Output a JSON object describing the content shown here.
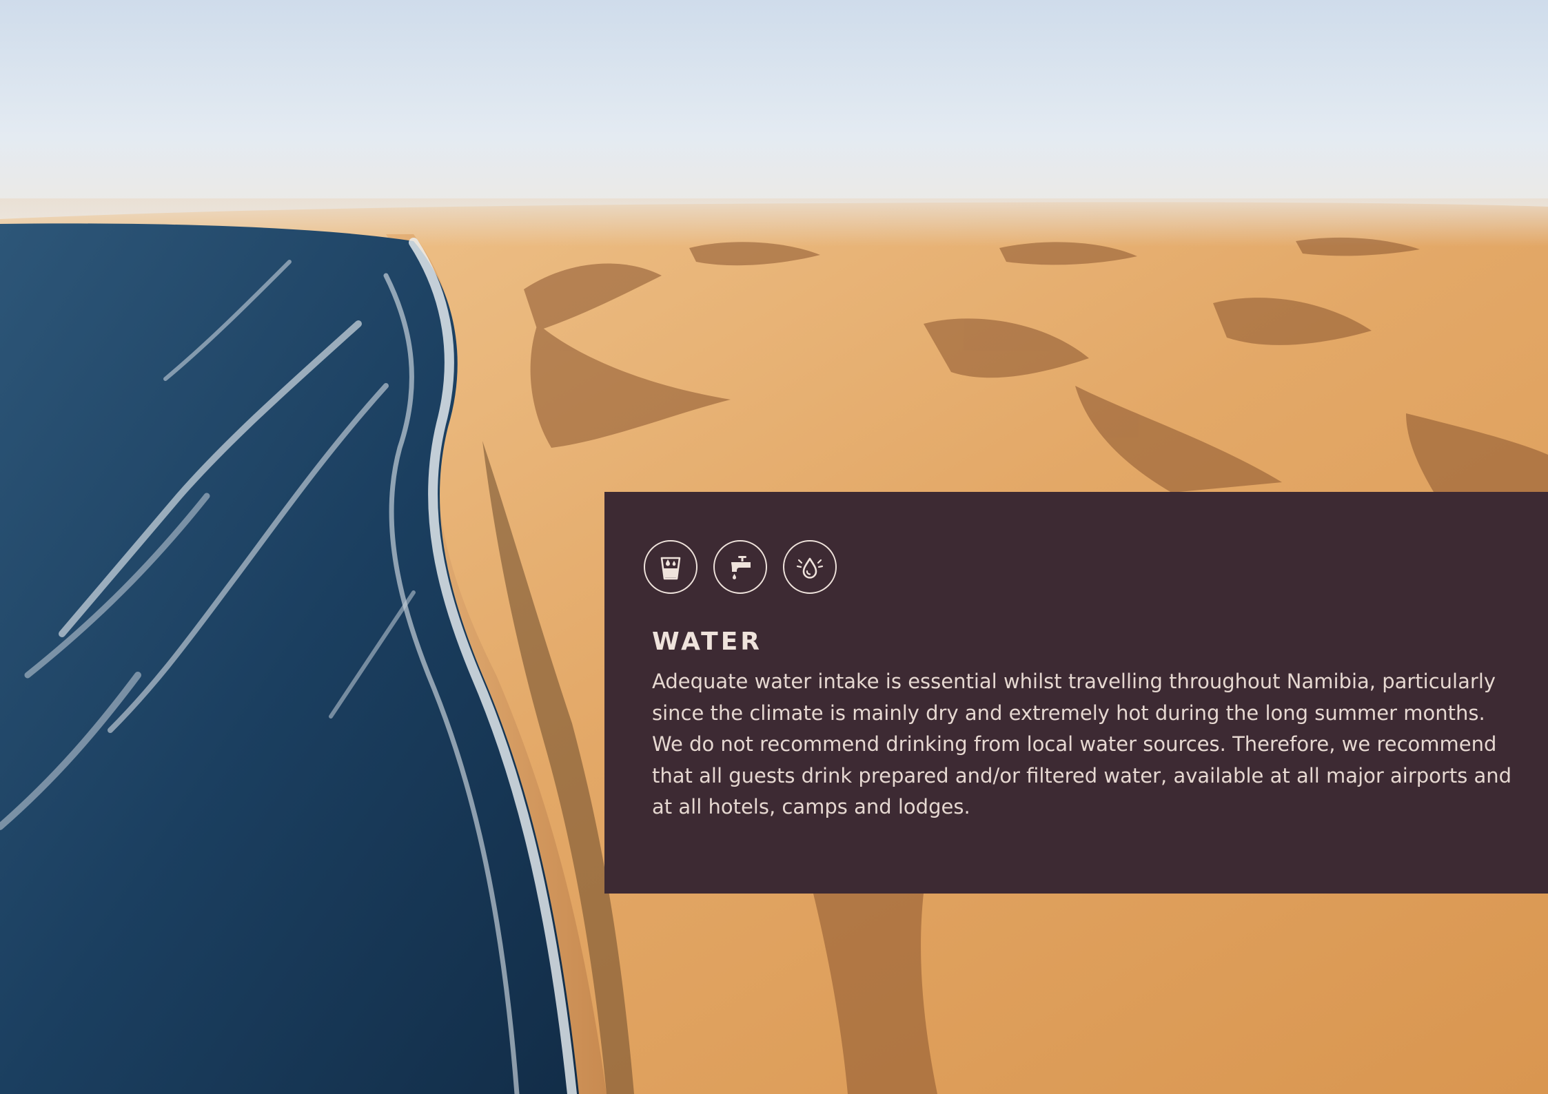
{
  "section": {
    "title": "WATER",
    "body": "Adequate water intake is essential whilst travelling throughout Namibia, particularly since the climate is mainly dry and extremely hot during the long summer months. We do not recommend drinking from local water sources. Therefore, we recommend that all guests drink prepared and/or filtered water, available at all major airports and at all hotels, camps and lodges."
  },
  "icons": [
    "water-glass-icon",
    "water-tap-icon",
    "water-drop-icon"
  ],
  "colors": {
    "panel": "#3d2a33",
    "panel_text": "#e6d8d1",
    "icon_line": "#efe3dc",
    "sky": "#dbe6f0",
    "sand": "#e0a868",
    "ocean": "#1c3f5e"
  }
}
